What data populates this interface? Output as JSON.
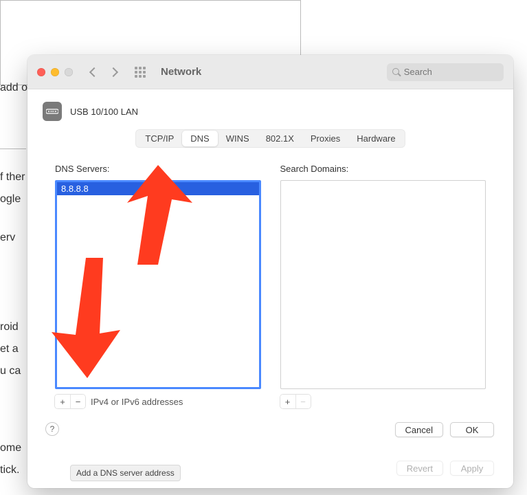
{
  "bg_fragments": [
    "f ther",
    "ogle",
    "erv",
    "roid",
    "et a",
    "u ca",
    "ome",
    "tick.",
    "add on"
  ],
  "titlebar": {
    "title": "Network",
    "search_placeholder": "Search"
  },
  "interface": {
    "icon_name": "ethernet-icon",
    "name": "USB 10/100 LAN"
  },
  "tabs": {
    "items": [
      "TCP/IP",
      "DNS",
      "WINS",
      "802.1X",
      "Proxies",
      "Hardware"
    ],
    "active_index": 1
  },
  "dns_col": {
    "label": "DNS Servers:",
    "entries": [
      "8.8.8.8"
    ],
    "selected_index": 0,
    "hint": "IPv4 or IPv6 addresses"
  },
  "domains_col": {
    "label": "Search Domains:",
    "entries": []
  },
  "tooltip_text": "Add a DNS server address",
  "buttons": {
    "help": "?",
    "plus": "+",
    "minus": "−",
    "cancel": "Cancel",
    "ok": "OK",
    "revert": "Revert",
    "apply": "Apply"
  },
  "annotation_color": "#ff3b1f"
}
